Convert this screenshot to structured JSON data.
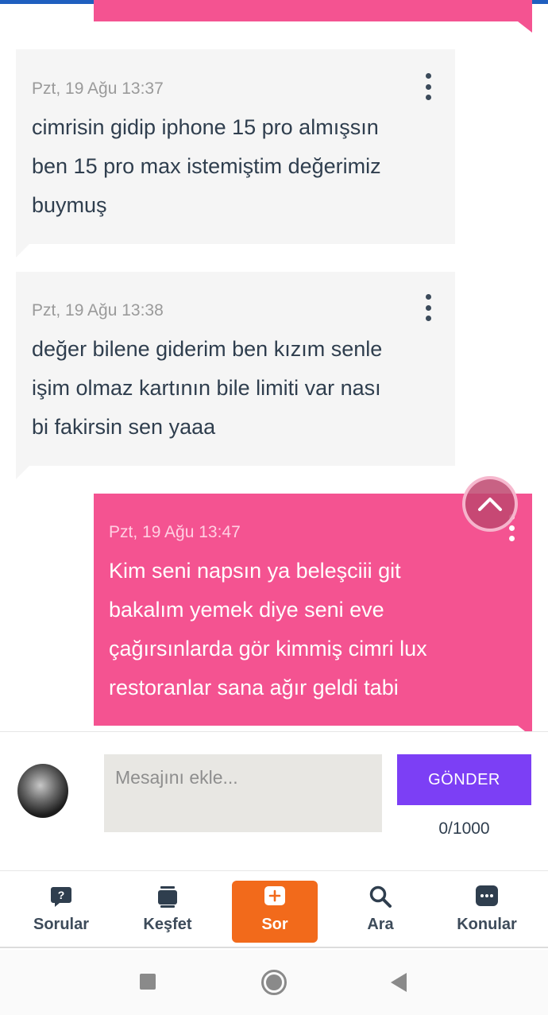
{
  "messages": [
    {
      "direction": "in",
      "time": "Pzt, 19 Ağu 13:37",
      "lines": [
        "cimrisin gidip iphone 15 pro almışsın",
        "ben 15 pro max istemiştim değerimiz",
        "buymuş"
      ]
    },
    {
      "direction": "in",
      "time": "Pzt, 19 Ağu 13:38",
      "lines": [
        "değer bilene giderim ben kızım senle",
        "işim olmaz kartının bile limiti var nası",
        "bi fakirsin sen yaaa"
      ]
    },
    {
      "direction": "out",
      "time": "Pzt, 19 Ağu 13:47",
      "lines": [
        "Kim seni napsın ya beleşciii git",
        "bakalım yemek diye seni eve",
        "çağırsınlarda gör kimmiş cimri lux",
        "restoranlar sana ağır geldi tabi"
      ]
    }
  ],
  "composer": {
    "placeholder": "Mesajını ekle...",
    "send_label": "GÖNDER",
    "counter": "0/1000"
  },
  "tabs": [
    {
      "label": "Sorular",
      "icon": "question-bubble-icon"
    },
    {
      "label": "Keşfet",
      "icon": "cards-stack-icon"
    },
    {
      "label": "Sor",
      "icon": "plus-box-icon",
      "active": true
    },
    {
      "label": "Ara",
      "icon": "search-icon"
    },
    {
      "label": "Konular",
      "icon": "chat-dots-icon"
    }
  ],
  "colors": {
    "incoming_bubble": "#f5f5f5",
    "outgoing_bubble": "#f45391",
    "send_button": "#7c3ff5",
    "active_tab": "#f26a1b",
    "top_bar": "#1f5fbf"
  },
  "system_nav": [
    "recent-apps-icon",
    "home-icon",
    "back-icon"
  ]
}
